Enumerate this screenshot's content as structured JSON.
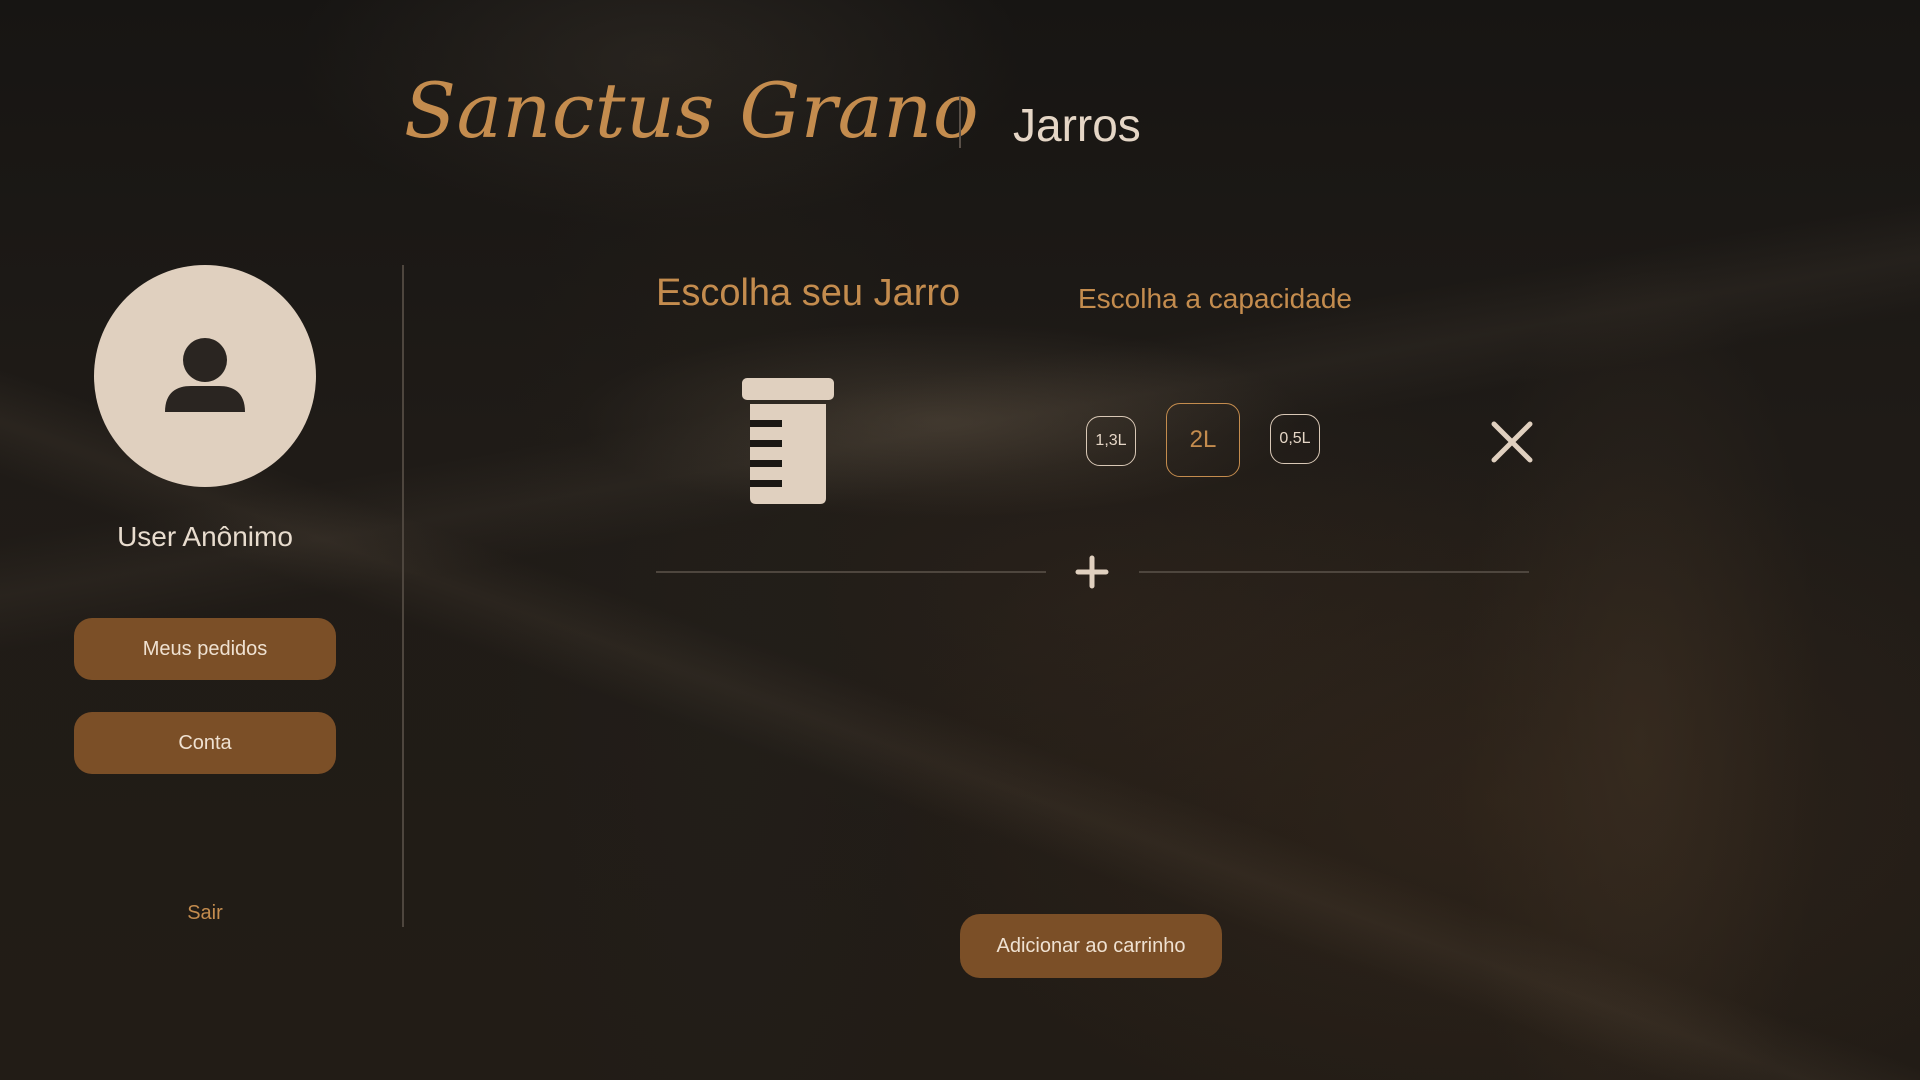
{
  "header": {
    "brand": "Sanctus Grano",
    "section_title": "Jarros"
  },
  "sidebar": {
    "username": "User Anônimo",
    "buttons": {
      "orders": "Meus pedidos",
      "account": "Conta"
    },
    "logout": "Sair",
    "avatar_icon": "user-icon"
  },
  "main": {
    "jar_title": "Escolha seu Jarro",
    "capacity_title": "Escolha a capacidade",
    "jar_icon": "jar-icon",
    "capacities": [
      "1,3L",
      "2L",
      "0,5L"
    ],
    "selected_capacity": "2L",
    "remove_icon": "close-icon",
    "add_icon": "plus-icon",
    "add_to_cart": "Adicionar ao carrinho"
  },
  "colors": {
    "accent": "#c48c4e",
    "button_bg": "#7b4f27",
    "text_light": "#e5d6c6",
    "avatar_bg": "#e0d0bf"
  }
}
